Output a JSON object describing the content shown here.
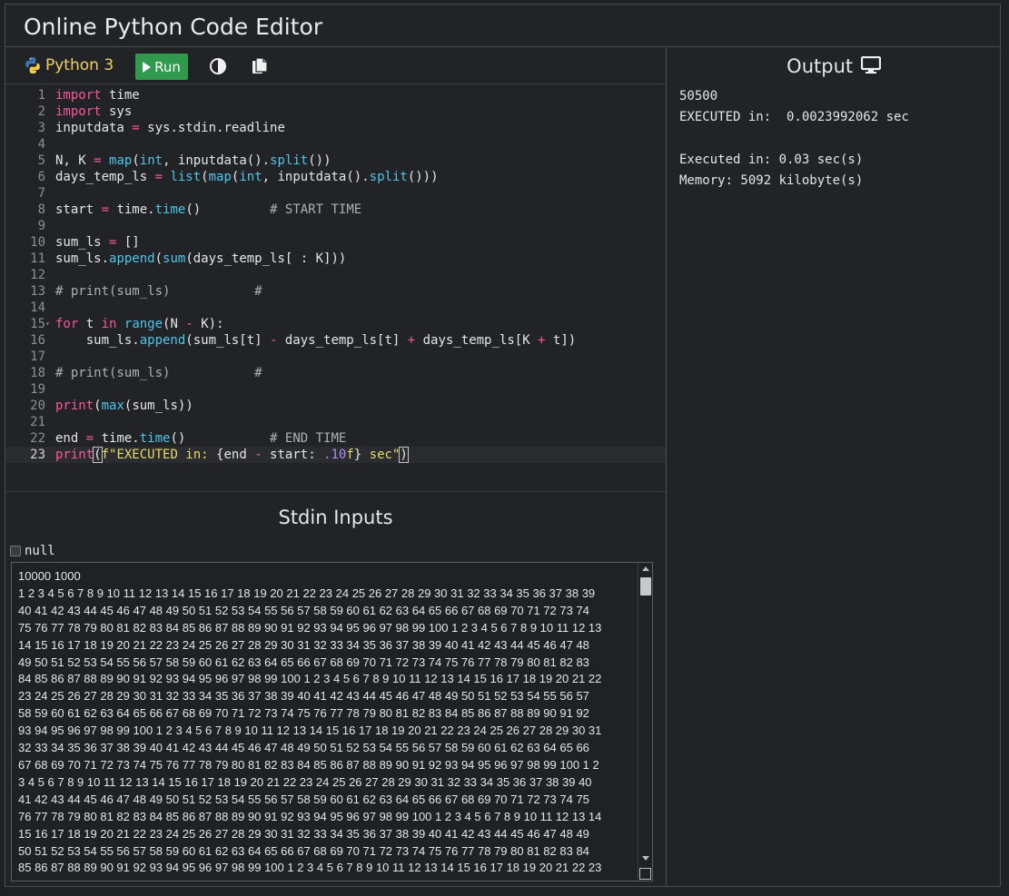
{
  "app": {
    "title": "Online Python Code Editor"
  },
  "toolbar": {
    "language": "Python 3",
    "run_label": "Run"
  },
  "editor": {
    "lines": [
      [
        [
          "kw",
          "import"
        ],
        [
          "t",
          " time"
        ]
      ],
      [
        [
          "kw",
          "import"
        ],
        [
          "t",
          " sys"
        ]
      ],
      [
        [
          "t",
          "inputdata "
        ],
        [
          "op",
          "="
        ],
        [
          "t",
          " sys.stdin.readline"
        ]
      ],
      [],
      [
        [
          "t",
          "N, K "
        ],
        [
          "op",
          "="
        ],
        [
          "t",
          " "
        ],
        [
          "fn",
          "map"
        ],
        [
          "t",
          "("
        ],
        [
          "fn",
          "int"
        ],
        [
          "t",
          ", inputdata()."
        ],
        [
          "fn",
          "split"
        ],
        [
          "t",
          "())"
        ]
      ],
      [
        [
          "t",
          "days_temp_ls "
        ],
        [
          "op",
          "="
        ],
        [
          "t",
          " "
        ],
        [
          "fn",
          "list"
        ],
        [
          "t",
          "("
        ],
        [
          "fn",
          "map"
        ],
        [
          "t",
          "("
        ],
        [
          "fn",
          "int"
        ],
        [
          "t",
          ", inputdata()."
        ],
        [
          "fn",
          "split"
        ],
        [
          "t",
          "()))"
        ]
      ],
      [],
      [
        [
          "t",
          "start "
        ],
        [
          "op",
          "="
        ],
        [
          "t",
          " time."
        ],
        [
          "fn",
          "time"
        ],
        [
          "t",
          "()         "
        ],
        [
          "cm",
          "# START TIME"
        ]
      ],
      [],
      [
        [
          "t",
          "sum_ls "
        ],
        [
          "op",
          "="
        ],
        [
          "t",
          " []"
        ]
      ],
      [
        [
          "t",
          "sum_ls."
        ],
        [
          "fn",
          "append"
        ],
        [
          "t",
          "("
        ],
        [
          "fn",
          "sum"
        ],
        [
          "t",
          "(days_temp_ls[ : K]))"
        ]
      ],
      [],
      [
        [
          "cm",
          "# print(sum_ls)           #"
        ]
      ],
      [],
      [
        [
          "kw",
          "for"
        ],
        [
          "t",
          " t "
        ],
        [
          "kw",
          "in"
        ],
        [
          "t",
          " "
        ],
        [
          "fn",
          "range"
        ],
        [
          "t",
          "(N "
        ],
        [
          "op",
          "-"
        ],
        [
          "t",
          " K):"
        ]
      ],
      [
        [
          "t",
          "    sum_ls."
        ],
        [
          "fn",
          "append"
        ],
        [
          "t",
          "(sum_ls[t] "
        ],
        [
          "op",
          "-"
        ],
        [
          "t",
          " days_temp_ls[t] "
        ],
        [
          "op",
          "+"
        ],
        [
          "t",
          " days_temp_ls[K "
        ],
        [
          "op",
          "+"
        ],
        [
          "t",
          " t])"
        ]
      ],
      [],
      [
        [
          "cm",
          "# print(sum_ls)           #"
        ]
      ],
      [],
      [
        [
          "kw",
          "print"
        ],
        [
          "t",
          "("
        ],
        [
          "fn",
          "max"
        ],
        [
          "t",
          "(sum_ls))"
        ]
      ],
      [],
      [
        [
          "t",
          "end "
        ],
        [
          "op",
          "="
        ],
        [
          "t",
          " time."
        ],
        [
          "fn",
          "time"
        ],
        [
          "t",
          "()           "
        ],
        [
          "cm",
          "# END TIME"
        ]
      ],
      [
        [
          "kw",
          "print"
        ],
        [
          "bkt",
          "("
        ],
        [
          "str",
          "f\"EXECUTED in: "
        ],
        [
          "t",
          "{end "
        ],
        [
          "op",
          "-"
        ],
        [
          "t",
          " start: "
        ],
        [
          "num",
          ".10"
        ],
        [
          "str",
          "f"
        ],
        [
          "t",
          "}"
        ],
        [
          "str",
          " sec\""
        ],
        [
          "bkt",
          ")"
        ]
      ]
    ],
    "fold_line": 15,
    "active_line": 23
  },
  "stdin": {
    "title": "Stdin Inputs",
    "null_label": "null",
    "lines": [
      "10000 1000",
      "1 2 3 4 5 6 7 8 9 10 11 12 13 14 15 16 17 18 19 20 21 22 23 24 25 26 27 28 29 30 31 32 33 34 35 36 37 38 39",
      "40 41 42 43 44 45 46 47 48 49 50 51 52 53 54 55 56 57 58 59 60 61 62 63 64 65 66 67 68 69 70 71 72 73 74",
      "75 76 77 78 79 80 81 82 83 84 85 86 87 88 89 90 91 92 93 94 95 96 97 98 99 100 1 2 3 4 5 6 7 8 9 10 11 12 13",
      "14 15 16 17 18 19 20 21 22 23 24 25 26 27 28 29 30 31 32 33 34 35 36 37 38 39 40 41 42 43 44 45 46 47 48",
      "49 50 51 52 53 54 55 56 57 58 59 60 61 62 63 64 65 66 67 68 69 70 71 72 73 74 75 76 77 78 79 80 81 82 83",
      "84 85 86 87 88 89 90 91 92 93 94 95 96 97 98 99 100 1 2 3 4 5 6 7 8 9 10 11 12 13 14 15 16 17 18 19 20 21 22",
      "23 24 25 26 27 28 29 30 31 32 33 34 35 36 37 38 39 40 41 42 43 44 45 46 47 48 49 50 51 52 53 54 55 56 57",
      "58 59 60 61 62 63 64 65 66 67 68 69 70 71 72 73 74 75 76 77 78 79 80 81 82 83 84 85 86 87 88 89 90 91 92",
      "93 94 95 96 97 98 99 100 1 2 3 4 5 6 7 8 9 10 11 12 13 14 15 16 17 18 19 20 21 22 23 24 25 26 27 28 29 30 31",
      "32 33 34 35 36 37 38 39 40 41 42 43 44 45 46 47 48 49 50 51 52 53 54 55 56 57 58 59 60 61 62 63 64 65 66",
      "67 68 69 70 71 72 73 74 75 76 77 78 79 80 81 82 83 84 85 86 87 88 89 90 91 92 93 94 95 96 97 98 99 100 1 2",
      "3 4 5 6 7 8 9 10 11 12 13 14 15 16 17 18 19 20 21 22 23 24 25 26 27 28 29 30 31 32 33 34 35 36 37 38 39 40",
      "41 42 43 44 45 46 47 48 49 50 51 52 53 54 55 56 57 58 59 60 61 62 63 64 65 66 67 68 69 70 71 72 73 74 75",
      "76 77 78 79 80 81 82 83 84 85 86 87 88 89 90 91 92 93 94 95 96 97 98 99 100 1 2 3 4 5 6 7 8 9 10 11 12 13 14",
      "15 16 17 18 19 20 21 22 23 24 25 26 27 28 29 30 31 32 33 34 35 36 37 38 39 40 41 42 43 44 45 46 47 48 49",
      "50 51 52 53 54 55 56 57 58 59 60 61 62 63 64 65 66 67 68 69 70 71 72 73 74 75 76 77 78 79 80 81 82 83 84",
      "85 86 87 88 89 90 91 92 93 94 95 96 97 98 99 100 1 2 3 4 5 6 7 8 9 10 11 12 13 14 15 16 17 18 19 20 21 22 23"
    ]
  },
  "output": {
    "title": "Output",
    "lines": [
      "50500",
      "EXECUTED in:  0.0023992062 sec",
      "",
      "Executed in: 0.03 sec(s)",
      "Memory: 5092 kilobyte(s)"
    ]
  },
  "colors": {
    "background": "#212327",
    "run_button": "#2f9a4d",
    "keyword": "#f6599c",
    "builtin": "#4fc6e8",
    "string": "#e7d96c",
    "number": "#a98bf2",
    "language_label": "#f1d166"
  },
  "icons": [
    "python-logo-icon",
    "play-icon",
    "contrast-icon",
    "copy-icon",
    "monitor-icon"
  ]
}
